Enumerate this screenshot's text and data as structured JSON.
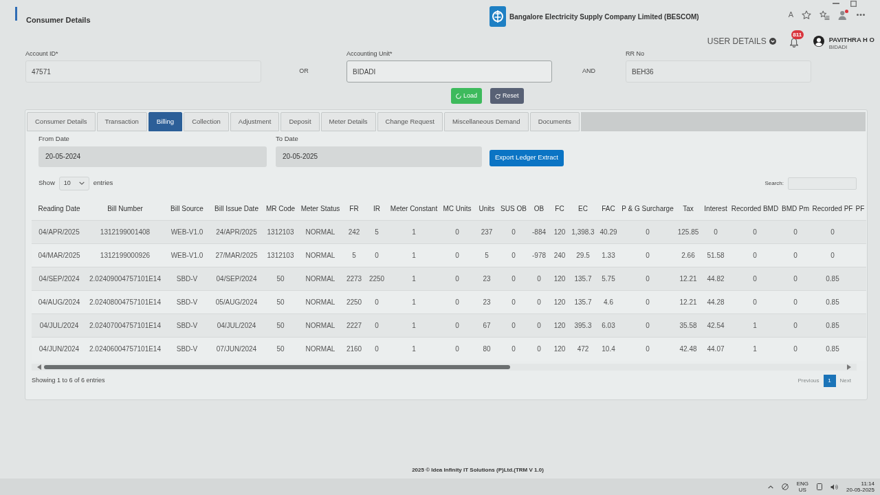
{
  "header": {
    "title": "Consumer Details",
    "company": "Bangalore Electricity Supply Company Limited (BESCOM)"
  },
  "browser_toolbar": {
    "read_aloud": "A"
  },
  "user": {
    "menu_label": "USER DETAILS",
    "notification_count": "811",
    "name": "PAVITHRA H O",
    "location": "BIDADI"
  },
  "search_form": {
    "fields": [
      {
        "label": "Account ID*",
        "value": "47571"
      },
      {
        "label": "Accounting Unit*",
        "value": "BIDADI"
      },
      {
        "label": "RR No",
        "value": "BEH36"
      }
    ],
    "connectors": [
      "OR",
      "AND"
    ],
    "buttons": [
      {
        "label": "Load",
        "kind": "load"
      },
      {
        "label": "Reset",
        "kind": "reset"
      }
    ]
  },
  "tabs": [
    {
      "label": "Consumer Details",
      "selected": false
    },
    {
      "label": "Transaction",
      "selected": false
    },
    {
      "label": "Billing",
      "selected": true
    },
    {
      "label": "Collection",
      "selected": false
    },
    {
      "label": "Adjustment",
      "selected": false
    },
    {
      "label": "Deposit",
      "selected": false
    },
    {
      "label": "Meter Details",
      "selected": false
    },
    {
      "label": "Change Request",
      "selected": false
    },
    {
      "label": "Miscellaneous Demand",
      "selected": false
    },
    {
      "label": "Documents",
      "selected": false
    }
  ],
  "billing": {
    "date_fields": [
      {
        "label": "From Date",
        "value": "20-05-2024"
      },
      {
        "label": "To Date",
        "value": "20-05-2025"
      }
    ],
    "export_button": "Export Ledger Extract",
    "length_menu": {
      "prefix": "Show",
      "value": "10",
      "suffix": "entries"
    },
    "search_label": "Search:",
    "table": {
      "columns": [
        "Reading Date",
        "Bill Number",
        "Bill Source",
        "Bill Issue Date",
        "MR Code",
        "Meter Status",
        "FR",
        "IR",
        "Meter Constant",
        "MC Units",
        "Units",
        "SUS OB",
        "OB",
        "FC",
        "EC",
        "FAC",
        "P & G Surcharge",
        "Tax",
        "Interest",
        "Recorded BMD",
        "BMD Pm",
        "Recorded PF",
        "PF"
      ],
      "rows": [
        [
          "04/APR/2025",
          "1312199001408",
          "WEB-V1.0",
          "24/APR/2025",
          "1312103",
          "NORMAL",
          "242",
          "5",
          "1",
          "0",
          "237",
          "0",
          "-884",
          "120",
          "1,398.3",
          "40.29",
          "0",
          "125.85",
          "0",
          "0",
          "0",
          "0"
        ],
        [
          "04/MAR/2025",
          "1312199000926",
          "WEB-V1.0",
          "27/MAR/2025",
          "1312103",
          "NORMAL",
          "5",
          "0",
          "1",
          "0",
          "5",
          "0",
          "-978",
          "240",
          "29.5",
          "1.33",
          "0",
          "2.66",
          "51.58",
          "0",
          "0",
          "0"
        ],
        [
          "04/SEP/2024",
          "2.02409004757101E14",
          "SBD-V",
          "04/SEP/2024",
          "50",
          "NORMAL",
          "2273",
          "2250",
          "1",
          "0",
          "23",
          "0",
          "0",
          "120",
          "135.7",
          "5.75",
          "0",
          "12.21",
          "44.82",
          "0",
          "0",
          "0.85"
        ],
        [
          "04/AUG/2024",
          "2.02408004757101E14",
          "SBD-V",
          "05/AUG/2024",
          "50",
          "NORMAL",
          "2250",
          "0",
          "1",
          "0",
          "23",
          "0",
          "0",
          "120",
          "135.7",
          "4.6",
          "0",
          "12.21",
          "44.28",
          "0",
          "0",
          "0.85"
        ],
        [
          "04/JUL/2024",
          "2.02407004757101E14",
          "SBD-V",
          "04/JUL/2024",
          "50",
          "NORMAL",
          "2227",
          "0",
          "1",
          "0",
          "67",
          "0",
          "0",
          "120",
          "395.3",
          "6.03",
          "0",
          "35.58",
          "42.54",
          "1",
          "0",
          "0.85"
        ],
        [
          "04/JUN/2024",
          "2.02406004757101E14",
          "SBD-V",
          "07/JUN/2024",
          "50",
          "NORMAL",
          "2160",
          "0",
          "1",
          "0",
          "80",
          "0",
          "0",
          "120",
          "472",
          "10.4",
          "0",
          "42.48",
          "44.07",
          "1",
          "0",
          "0.85"
        ]
      ]
    },
    "info": "Showing 1 to 6 of 6 entries",
    "pagination": {
      "previous": {
        "label": "Previous",
        "disabled": true
      },
      "pages": [
        {
          "label": "1",
          "selected": true
        }
      ],
      "next": {
        "label": "Next",
        "disabled": true
      }
    }
  },
  "footer": "2025 © Idea Infinity IT Solutions (P)Ltd.(TRM V 1.0)",
  "taskbar": {
    "language": "ENG",
    "region": "US",
    "time": "11:14",
    "date": "20-05-2025"
  }
}
